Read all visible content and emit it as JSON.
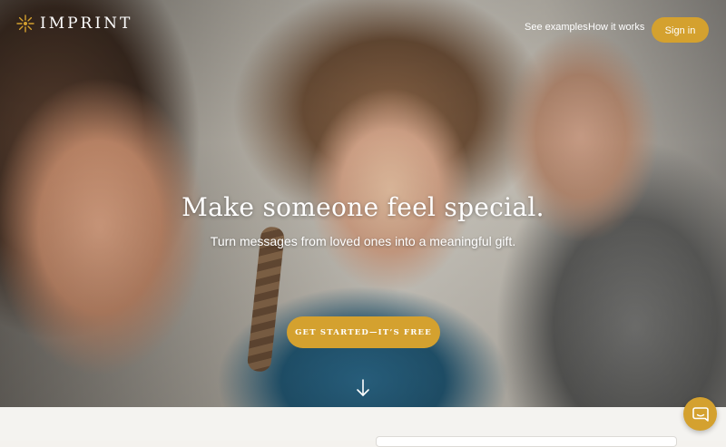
{
  "nav": {
    "logo_text": "IMPRINT",
    "logo_icon": "sunburst-icon",
    "links": [
      "See examples",
      "How it works"
    ],
    "sign_in_label": "Sign in"
  },
  "hero": {
    "headline": "Make someone feel special.",
    "subheadline": "Turn messages from loved ones into a meaningful gift.",
    "cta_label": "GET STARTED—IT’S FREE",
    "scroll_icon": "arrow-down-icon"
  },
  "chat": {
    "icon": "chat-bubble-icon"
  },
  "colors": {
    "accent": "#d4a12f",
    "text_on_hero": "#ffffff"
  }
}
